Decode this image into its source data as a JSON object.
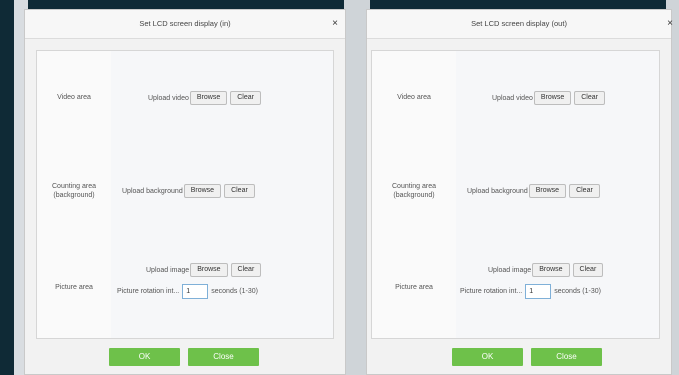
{
  "dialogs": [
    {
      "title": "Set LCD screen display (in)",
      "close_icon": "×",
      "rows": {
        "video": {
          "label": "Video area",
          "upload_label": "Upload video",
          "browse": "Browse",
          "clear": "Clear"
        },
        "counting": {
          "label": "Counting area (background)",
          "upload_label": "Upload background",
          "browse": "Browse",
          "clear": "Clear"
        },
        "picture": {
          "label": "Picture area",
          "upload_label": "Upload image",
          "browse": "Browse",
          "clear": "Clear",
          "rotation_label": "Picture rotation int...",
          "rotation_value": "1",
          "rotation_unit": "seconds (1-30)"
        }
      },
      "ok": "OK",
      "close": "Close"
    },
    {
      "title": "Set LCD screen display (out)",
      "close_icon": "×",
      "rows": {
        "video": {
          "label": "Video area",
          "upload_label": "Upload video",
          "browse": "Browse",
          "clear": "Clear"
        },
        "counting": {
          "label": "Counting area (background)",
          "upload_label": "Upload background",
          "browse": "Browse",
          "clear": "Clear"
        },
        "picture": {
          "label": "Picture area",
          "upload_label": "Upload image",
          "browse": "Browse",
          "clear": "Clear",
          "rotation_label": "Picture rotation int...",
          "rotation_value": "1",
          "rotation_unit": "seconds (1-30)"
        }
      },
      "ok": "OK",
      "close": "Close"
    }
  ],
  "colors": {
    "accent_green": "#6ec14a",
    "background": "#0f2a36"
  }
}
